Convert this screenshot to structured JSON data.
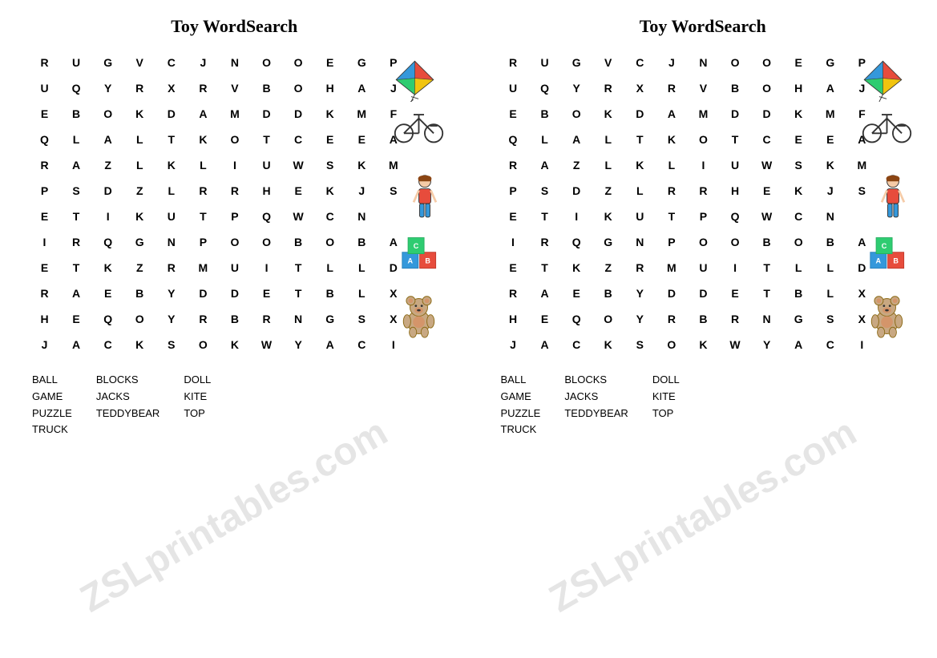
{
  "title": "Toy WordSearch",
  "grid": [
    [
      "R",
      "U",
      "G",
      "V",
      "C",
      "J",
      "N",
      "O",
      "O",
      "E",
      "G",
      "P",
      ""
    ],
    [
      "U",
      "Q",
      "Y",
      "R",
      "X",
      "R",
      "V",
      "B",
      "O",
      "H",
      "A",
      "J",
      ""
    ],
    [
      "E",
      "B",
      "O",
      "K",
      "D",
      "A",
      "M",
      "D",
      "D",
      "K",
      "M",
      "F",
      ""
    ],
    [
      "Q",
      "L",
      "A",
      "L",
      "T",
      "K",
      "O",
      "T",
      "C",
      "E",
      "E",
      "A",
      ""
    ],
    [
      "R",
      "A",
      "Z",
      "L",
      "K",
      "L",
      "I",
      "U",
      "W",
      "S",
      "K",
      "M",
      ""
    ],
    [
      "P",
      "S",
      "D",
      "Z",
      "L",
      "R",
      "R",
      "H",
      "E",
      "K",
      "J",
      "S",
      ""
    ],
    [
      "E",
      "T",
      "I",
      "K",
      "U",
      "T",
      "P",
      "Q",
      "W",
      "C",
      "N",
      "",
      ""
    ],
    [
      "I",
      "R",
      "Q",
      "G",
      "N",
      "P",
      "O",
      "O",
      "B",
      "O",
      "B",
      "A",
      ""
    ],
    [
      "E",
      "T",
      "K",
      "Z",
      "R",
      "M",
      "U",
      "I",
      "T",
      "L",
      "L",
      "D",
      ""
    ],
    [
      "R",
      "A",
      "E",
      "B",
      "Y",
      "D",
      "D",
      "E",
      "T",
      "B",
      "L",
      "X",
      ""
    ],
    [
      "H",
      "E",
      "Q",
      "O",
      "Y",
      "R",
      "B",
      "R",
      "N",
      "G",
      "S",
      "X",
      ""
    ],
    [
      "J",
      "A",
      "C",
      "K",
      "S",
      "O",
      "K",
      "W",
      "Y",
      "A",
      "C",
      "I",
      ""
    ]
  ],
  "wordList": {
    "col1": [
      "BALL",
      "GAME",
      "PUZZLE",
      "TRUCK"
    ],
    "col2": [
      "BLOCKS",
      "JACKS",
      "TEDDYBEAR"
    ],
    "col3": [
      "DOLL",
      "KITE",
      "TOP"
    ]
  },
  "watermark": "ZSLprintables.com"
}
